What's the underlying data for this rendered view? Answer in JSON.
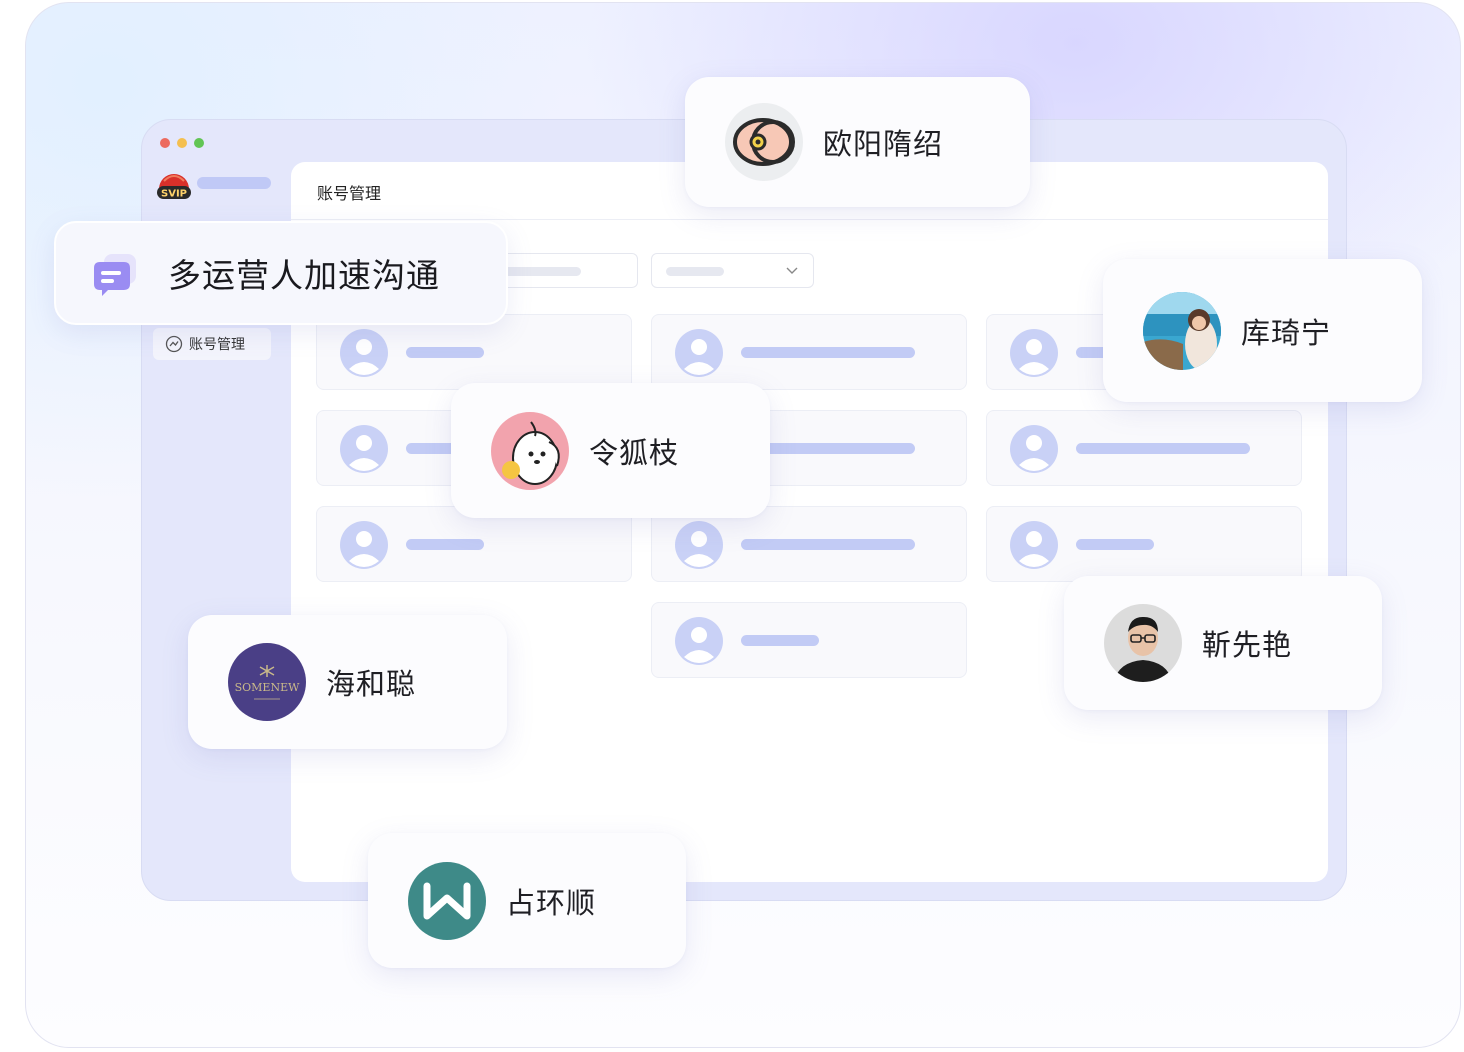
{
  "window": {
    "traffic_lights": [
      "#ec6a5e",
      "#f4bf4f",
      "#61c554"
    ],
    "logo_text": "SVIP"
  },
  "sidebar": {
    "account_item": "账号管理"
  },
  "panel": {
    "title": "账号管理"
  },
  "feature_banner": {
    "text": "多运营人加速沟通",
    "icon": "chat-bubble-icon"
  },
  "contacts": [
    {
      "name": "欧阳隋绍",
      "avatar": "eye-logo-avatar"
    },
    {
      "name": "库琦宁",
      "avatar": "seaside-photo-avatar"
    },
    {
      "name": "令狐枝",
      "avatar": "cartoon-dog-avatar"
    },
    {
      "name": "靳先艳",
      "avatar": "man-with-glasses-avatar"
    },
    {
      "name": "海和聪",
      "avatar": "somenew-logo-avatar",
      "logo_text": "SOMENEW"
    },
    {
      "name": "占环顺",
      "avatar": "w-logo-avatar"
    }
  ],
  "colors": {
    "accent": "#c2cbf5",
    "window_bg": "#e4e7fb",
    "chat_icon": "#9a8cf2"
  }
}
